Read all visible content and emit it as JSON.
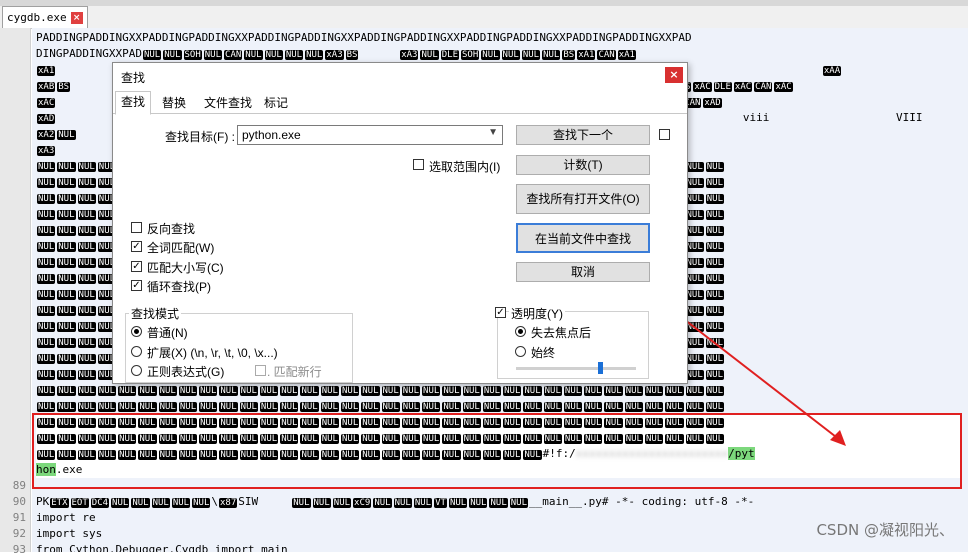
{
  "editor": {
    "tab_label": "cygdb.exe",
    "tab_close": "×",
    "line_numbers": [
      "89",
      "90",
      "91",
      "92",
      "93"
    ],
    "lines": [
      "PADDINGPADDINGXXPADDINGPADDINGXXPADDINGPADDINGXXPADDINGPADDINGXXPADDINGPADDINGXXPADDINGPADDINGXXPAD",
      "DINGPADDINGXXPAD",
      "viii",
      "VIII",
      "#!f:/",
      "/pyt",
      "hon",
      ".exe",
      "main",
      ".py# -*- coding: utf-8 -*-",
      "import re",
      "import sys",
      "from Cython.Debugger.Cygdb import main"
    ],
    "ctrl_tokens": {
      "nul": "NUL",
      "soh": "SOH",
      "can": "CAN",
      "xa3": "xA3",
      "bs": "BS",
      "dle": "DLE",
      "xa1": "xA1",
      "xaa": "xAA",
      "xab": "xAB",
      "xac": "xAC",
      "xad": "xAD",
      "xa2": "xA2",
      "etx": "ETX",
      "eot": "EOT",
      "dc4": "DC4",
      "x87": "x87",
      "xc9": "xC9",
      "vt": "VT"
    }
  },
  "dialog": {
    "title": "查找",
    "close": "×",
    "tabs": [
      "查找",
      "替换",
      "文件查找",
      "标记"
    ],
    "find_label": "查找目标(F) :",
    "find_value": "python.exe",
    "buttons": {
      "find_next": "查找下一个",
      "count": "计数(T)",
      "find_all_open": "查找所有打开文件(O)",
      "find_all_current": "在当前文件中查找",
      "cancel": "取消"
    },
    "in_selection": "选取范围内(I)",
    "options": [
      {
        "label": "反向查找",
        "checked": false
      },
      {
        "label": "全词匹配(W)",
        "checked": true
      },
      {
        "label": "匹配大小写(C)",
        "checked": true
      },
      {
        "label": "循环查找(P)",
        "checked": true
      }
    ],
    "mode_title": "查找模式",
    "modes": [
      {
        "label": "普通(N)",
        "selected": true
      },
      {
        "label": "扩展(X) (\\n, \\r, \\t, \\0, \\x...)",
        "selected": false
      },
      {
        "label": "正则表达式(G)",
        "selected": false
      }
    ],
    "match_newline": ". 匹配新行",
    "transparency": "透明度(Y)",
    "transparency_checked": true,
    "trans_modes": [
      {
        "label": "失去焦点后",
        "selected": true
      },
      {
        "label": "始终",
        "selected": false
      }
    ],
    "transparency_level": 0.7
  },
  "watermark": "CSDN @凝视阳光、"
}
